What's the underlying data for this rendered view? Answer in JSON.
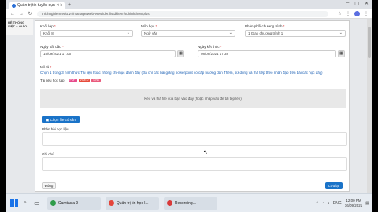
{
  "browser": {
    "tab_title": "Quản trị tin tuyển dụn ✕ Trường",
    "url": "thichnghiem.edu.vn/manage/web-ereslider/listdkitem/tohinhthon/plus",
    "tab_close": "x",
    "new_tab": "+"
  },
  "page_bg": {
    "left_text": "HỆ THỐNG VIỆT Á GIÁO"
  },
  "form": {
    "khoi_label": "Khối lớp",
    "khoi_value": "Khối 8",
    "mon_label": "Môn học",
    "mon_value": "Ngữ văn",
    "phan_label": "Phân phối chương trình",
    "phan_value": "1 Giao chương trình 1",
    "start_label": "Ngày bắt đầu",
    "start_value": "15/09/2021 17:06",
    "end_label": "Ngày kết thúc",
    "end_value": "08/09/2021 17:38",
    "desc_label": "Mô tả",
    "desc_text": "Chọn 1 trong 3 hình thức Tài liệu hoặc nhóng chỉ-mục danh đây (Đã chỉ các bài giảng powerpoint có cấp hướng dẫn Thêm, sử dụng và thả tiếp theo nhấn đạo trên bài các học đây)",
    "tags_label": "Tài liệu học tập",
    "tag1": "PDF",
    "tag2": "VIDEO",
    "tag3": "LINK",
    "drop_text": "Kéo và thả file của bạn vào đây (hoặc nhấp vào để tải tệp lên)",
    "choose_btn": "Chọn file có sẵn",
    "feedback_label": "Phản hồi học liệu",
    "note_label": "Ghi chú",
    "back_btn": "Đóng",
    "save_btn": "Lưu lại"
  },
  "taskbar": {
    "item1": "Camtasia 9",
    "item2": "Quản trị tin học l...",
    "item3": "Recording...",
    "time": "12:00 PM",
    "date": "16/09/2021",
    "lang": "ENG"
  },
  "colors": {
    "primary": "#1a73c8",
    "tag1": "#e74c8c",
    "tag2": "#e74c3c",
    "tag3": "#ea5b7d"
  }
}
